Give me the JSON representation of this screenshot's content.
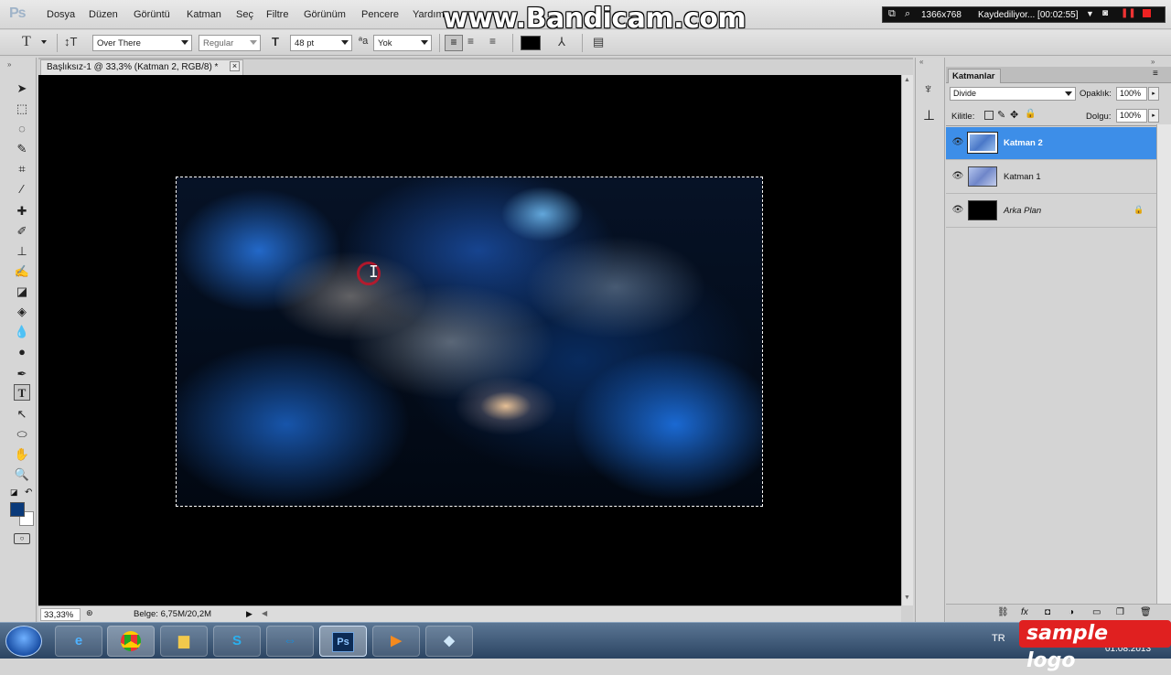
{
  "app": {
    "logo": "Ps",
    "menu": [
      "Dosya",
      "Düzen",
      "Görüntü",
      "Katman",
      "Seç",
      "Filtre",
      "Görünüm",
      "Pencere",
      "Yardım"
    ]
  },
  "watermark": "www.Bandicam.com",
  "recorder": {
    "resolution": "1366x768",
    "status": "Kaydediliyor... [00:02:55]"
  },
  "options": {
    "font_family": "Over There",
    "font_style": "Regular",
    "font_size": "48 pt",
    "antialias": "Yok",
    "text_color": "#000000"
  },
  "document": {
    "tab_title": "Başlıksız-1 @ 33,3% (Katman 2, RGB/8) *",
    "close": "×",
    "zoom": "33,33%",
    "doc_info": "Belge: 6,75M/20,2M"
  },
  "colors": {
    "foreground": "#0a3a7a",
    "background": "#ffffff",
    "selected_layer": "#3d8ee8"
  },
  "layers": {
    "tab": "Katmanlar",
    "blend_mode": "Divide",
    "opacity_label": "Opaklık:",
    "opacity": "100%",
    "lock_label": "Kilitle:",
    "fill_label": "Dolgu:",
    "fill": "100%",
    "items": [
      {
        "name": "Katman 2",
        "selected": true,
        "visible": true
      },
      {
        "name": "Katman 1",
        "selected": false,
        "visible": true
      },
      {
        "name": "Arka Plan",
        "selected": false,
        "visible": true,
        "locked": true
      }
    ]
  },
  "taskbar": {
    "apps": [
      "internet-explorer",
      "chrome",
      "explorer",
      "skype",
      "teamviewer",
      "photoshop",
      "media-player",
      "eraser"
    ],
    "lang": "TR",
    "date": "01.08.2013",
    "overlay_logo": "sample logo"
  }
}
